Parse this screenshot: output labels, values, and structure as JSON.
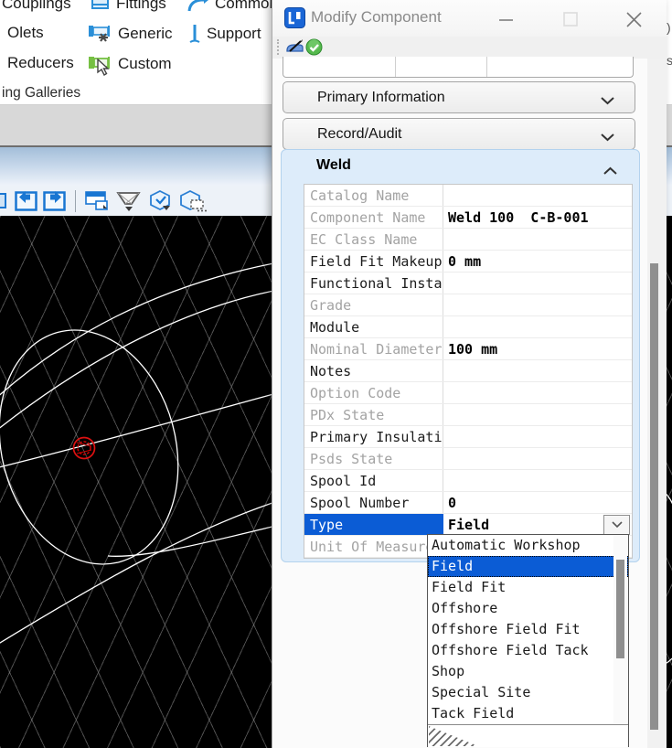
{
  "ribbon": {
    "items": [
      {
        "label": "Couplings"
      },
      {
        "label": "Fittings",
        "icon": "fitting-icon"
      },
      {
        "label": "Common",
        "icon": "elbow-arrow-icon"
      },
      {
        "label": "Olets",
        "icon": "olet-fragment-icon"
      },
      {
        "label": "Generic",
        "icon": "generic-pipe-icon"
      },
      {
        "label": "Support",
        "icon": "support-icon"
      },
      {
        "label": "Reducers"
      },
      {
        "label": "Custom",
        "icon": "custom-pipe-icon"
      }
    ],
    "group_label": "ing Galleries",
    "edge_fragments": [
      ")",
      "s"
    ]
  },
  "view_toolbar": {
    "icons": [
      "window-partial-icon",
      "view-previous-icon",
      "view-next-icon",
      "copy-view-icon",
      "display-style-icon",
      "clip-volume-icon",
      "clip-mask-icon"
    ]
  },
  "dialog": {
    "title": "Modify Component",
    "window_buttons": {
      "minimize": "minimize-icon",
      "maximize": "maximize-icon",
      "close": "close-icon"
    },
    "toolbar_icons": [
      "modify-component-icon",
      "accept-icon"
    ],
    "sections": [
      {
        "label": "Primary Information",
        "state": "collapsed"
      },
      {
        "label": "Record/Audit",
        "state": "collapsed"
      },
      {
        "label": "Weld",
        "state": "expanded"
      }
    ],
    "weld": {
      "rows": [
        {
          "label": "Catalog Name",
          "value": "",
          "muted": true
        },
        {
          "label": "Component Name",
          "value": "Weld 100  C-B-001",
          "muted": true,
          "bold": true
        },
        {
          "label": "EC Class Name",
          "value": "",
          "muted": true
        },
        {
          "label": "Field Fit Makeup",
          "value": "0 mm",
          "muted": false,
          "bold": true
        },
        {
          "label": "Functional Instance",
          "value": "",
          "muted": false
        },
        {
          "label": "Grade",
          "value": "",
          "muted": true
        },
        {
          "label": "Module",
          "value": "",
          "muted": false
        },
        {
          "label": "Nominal Diameter",
          "value": "100 mm",
          "muted": true,
          "bold": true
        },
        {
          "label": "Notes",
          "value": "",
          "muted": false
        },
        {
          "label": "Option Code",
          "value": "",
          "muted": true
        },
        {
          "label": "PDx State",
          "value": "",
          "muted": true
        },
        {
          "label": "Primary Insulation",
          "value": "",
          "muted": false
        },
        {
          "label": "Psds State",
          "value": "",
          "muted": true
        },
        {
          "label": "Spool Id",
          "value": "",
          "muted": false
        },
        {
          "label": "Spool Number",
          "value": "0",
          "muted": false,
          "bold": true
        },
        {
          "label": "Type",
          "value": "Field",
          "muted": false,
          "bold": true,
          "selected": true,
          "combo": true
        },
        {
          "label": "Unit Of Measure",
          "value": "",
          "muted": true
        }
      ]
    },
    "type_dropdown": {
      "selected": "Field",
      "options": [
        "Automatic Workshop",
        "Field",
        "Field Fit",
        "Offshore",
        "Offshore Field Fit",
        "Offshore Field Tack",
        "Shop",
        "Special Site",
        "Tack Field"
      ]
    }
  },
  "colors": {
    "selection_blue": "#0b5cd5",
    "weld_section_bg": "#ddecfa",
    "ribbon_icon_blue": "#2a8fd8",
    "custom_icon_green": "#76c043",
    "viewport_bg": "#000000",
    "marker_red": "#dd1111"
  }
}
